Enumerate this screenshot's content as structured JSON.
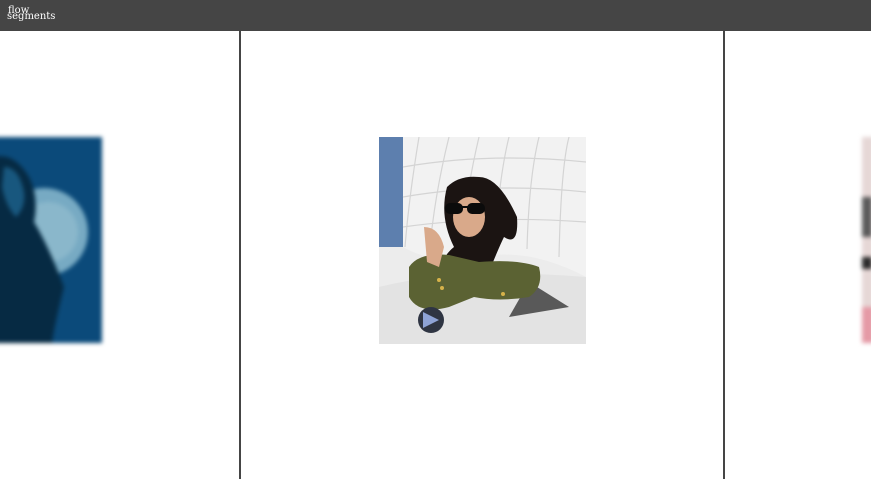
{
  "app": {
    "logo_line1": "flow",
    "logo_line2": "segments"
  },
  "slides": {
    "previous": {
      "icon": "portrait-thumbnail-blurred"
    },
    "current": {
      "icon": "portrait-thumbnail"
    },
    "next": {
      "icon": "portrait-thumbnail-blurred"
    }
  },
  "colors": {
    "header": "#454545",
    "panel": "#ffffff",
    "divider": "#454545"
  }
}
